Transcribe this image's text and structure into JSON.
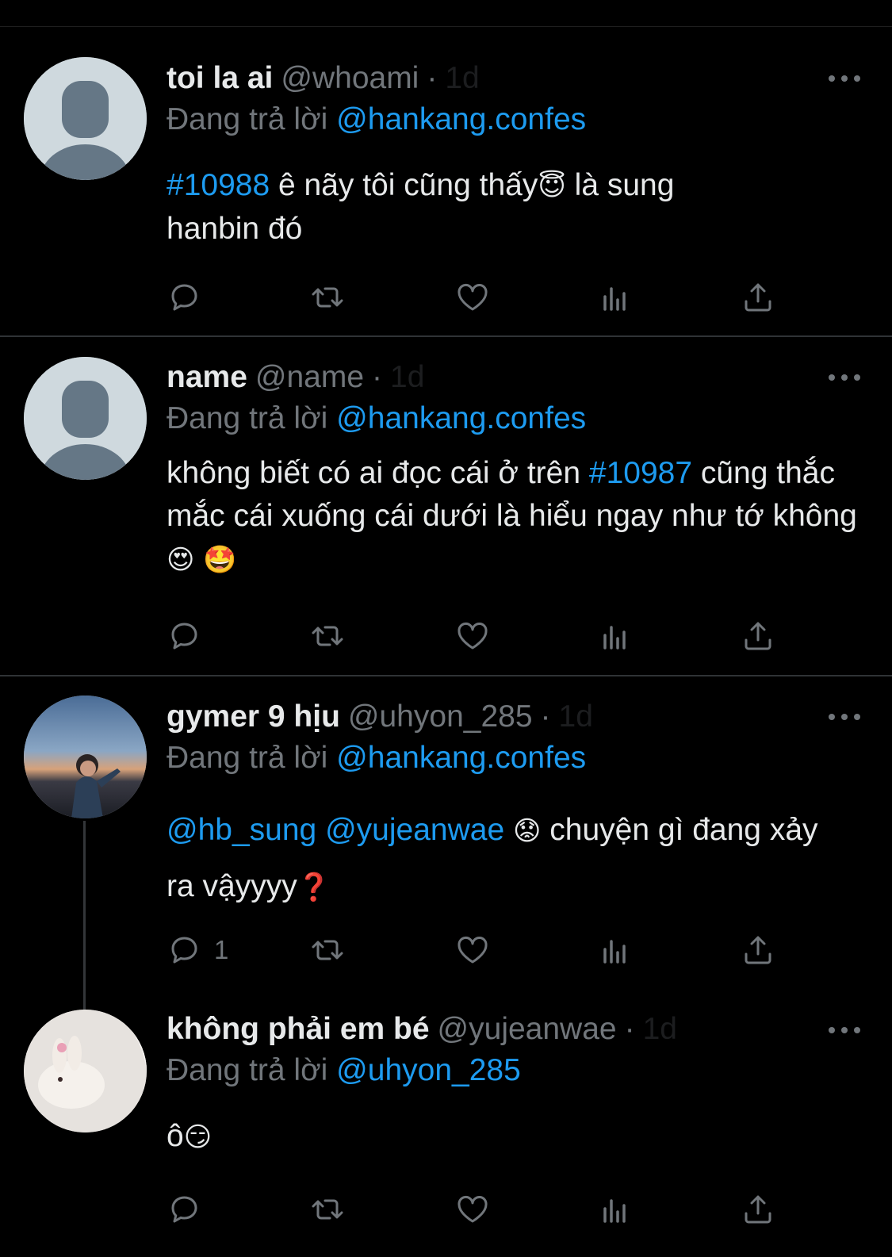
{
  "colors": {
    "background": "#000000",
    "text": "#e7e9ea",
    "muted": "#71767b",
    "link": "#1d9bf0",
    "divider": "#2f3336"
  },
  "tweets": [
    {
      "name": "toi la ai",
      "handle": "@whoami",
      "time": "1d",
      "reply_prefix": "Đang trả lời",
      "reply_to": "@hankang.confes",
      "body": [
        {
          "t": "#10988",
          "link": true
        },
        {
          "t": " ê nãy tôi cũng thấy"
        },
        {
          "t": "😇",
          "emoji": true
        },
        {
          "t": "  là sung hanbin đó"
        }
      ],
      "reply_count": ""
    },
    {
      "name": "name",
      "handle": "@name",
      "time": "1d",
      "reply_prefix": "Đang trả lời",
      "reply_to": "@hankang.confes",
      "body": [
        {
          "t": "không biết có ai đọc cái ở trên "
        },
        {
          "t": "#10987",
          "link": true
        },
        {
          "t": " cũng thắc mắc cái xuống cái dưới là hiểu ngay như tớ không"
        },
        {
          "t": "😍 🤩",
          "emoji": true
        }
      ],
      "reply_count": ""
    },
    {
      "name": "gymer 9 hịu",
      "handle": "@uhyon_285",
      "time": "1d",
      "reply_prefix": "Đang trả lời",
      "reply_to": "@hankang.confes",
      "body": [
        {
          "t": "@hb_sung",
          "link": true
        },
        {
          "t": " "
        },
        {
          "t": "@yujeanwae",
          "link": true
        },
        {
          "t": " "
        },
        {
          "t": "😟",
          "emoji": true
        },
        {
          "t": " chuyện gì đang xảy ra vậyyyy"
        },
        {
          "t": "❓",
          "emoji": true,
          "red": true
        }
      ],
      "reply_count": "1"
    },
    {
      "name": "không phải em bé",
      "handle": "@yujeanwae",
      "time": "1d",
      "reply_prefix": "Đang trả lời",
      "reply_to": "@uhyon_285",
      "body": [
        {
          "t": "ô"
        },
        {
          "t": "😏",
          "emoji": true
        }
      ],
      "reply_count": ""
    }
  ],
  "icons": [
    "reply-icon",
    "retweet-icon",
    "like-icon",
    "views-icon",
    "share-icon",
    "more-icon"
  ]
}
